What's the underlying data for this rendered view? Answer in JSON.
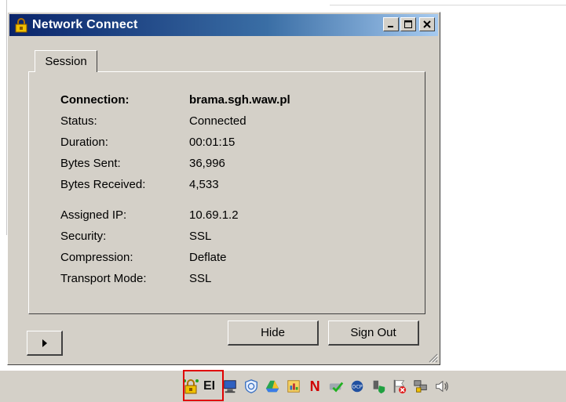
{
  "window": {
    "title": "Network Connect",
    "controls": {
      "minimize": "_",
      "maximize": "□",
      "close": "×"
    }
  },
  "tabs": [
    {
      "label": "Session",
      "active": true
    }
  ],
  "session": {
    "rows": [
      {
        "label": "Connection:",
        "value": "brama.sgh.waw.pl",
        "bold": true
      },
      {
        "label": "Status:",
        "value": "Connected"
      },
      {
        "label": "Duration:",
        "value": "00:01:15"
      },
      {
        "label": "Bytes Sent:",
        "value": "36,996"
      },
      {
        "label": "Bytes Received:",
        "value": "4,533"
      },
      {
        "label": "Assigned IP:",
        "value": "10.69.1.2"
      },
      {
        "label": "Security:",
        "value": "SSL"
      },
      {
        "label": "Compression:",
        "value": "Deflate"
      },
      {
        "label": "Transport Mode:",
        "value": "SSL"
      }
    ]
  },
  "buttons": {
    "hide": "Hide",
    "sign_out": "Sign Out"
  },
  "tray": {
    "el_label": "EI",
    "n_label": "N",
    "icons": [
      "network-connect-tray-icon",
      "el-icon",
      "monitor-icon",
      "shield-icon",
      "drive-icon",
      "chart-icon",
      "n-icon",
      "check-icon",
      "ocp-icon",
      "plug-shield-icon",
      "flag-x-icon",
      "network-lock-icon",
      "speaker-icon"
    ]
  },
  "colors": {
    "highlight": "#e00000",
    "titlebar": "#0a246a",
    "face": "#d4d0c8"
  }
}
